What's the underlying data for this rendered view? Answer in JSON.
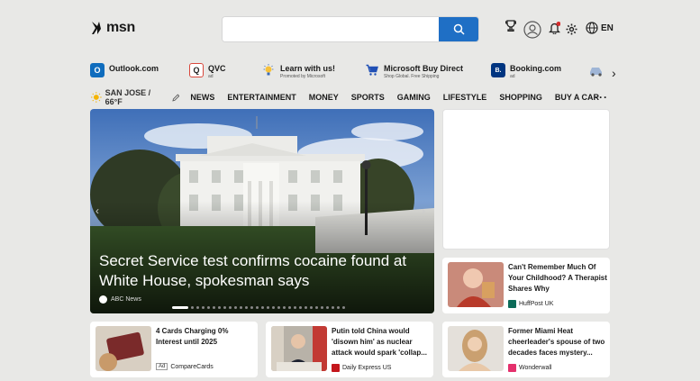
{
  "header": {
    "logo_text": "msn",
    "search_placeholder": "",
    "lang": "EN"
  },
  "quicklinks": [
    {
      "name": "Outlook.com",
      "sub": "",
      "color": "#0f6cbd",
      "glyph": "O"
    },
    {
      "name": "QVC",
      "sub": "ad",
      "color": "#ffffff",
      "glyph": "Q"
    },
    {
      "name": "Learn with us!",
      "sub": "Promoted by Microsoft",
      "color": "#ffffff",
      "glyph": ""
    },
    {
      "name": "Microsoft Buy Direct",
      "sub": "Shop Global. Free Shipping",
      "color": "#ffffff",
      "glyph": ""
    },
    {
      "name": "Booking.com",
      "sub": "ad",
      "color": "#003580",
      "glyph": "B."
    }
  ],
  "weather": {
    "text": "SAN JOSE / 66°F"
  },
  "nav": [
    "NEWS",
    "ENTERTAINMENT",
    "MONEY",
    "SPORTS",
    "GAMING",
    "LIFESTYLE",
    "SHOPPING",
    "BUY A CAR"
  ],
  "nav_more": "···",
  "hero": {
    "title": "Secret Service test confirms cocaine found at White House, spokesman says",
    "source": "ABC News",
    "slide_count": 30,
    "active_slide": 1
  },
  "cards": [
    {
      "title": "Can't Remember Much Of Your Childhood? A Therapist Shares Why",
      "source": "HuffPost UK",
      "ad": false,
      "logo_color": "#0c6b58"
    },
    {
      "title": "4 Cards Charging 0% Interest until 2025",
      "source": "CompareCards",
      "ad": true,
      "ad_label": "Ad",
      "logo_color": ""
    },
    {
      "title": "Putin told China would 'disown him' as nuclear attack would spark 'collap...",
      "source": "Daily Express US",
      "ad": false,
      "logo_color": "#c4161c"
    },
    {
      "title": "Former Miami Heat cheerleader's spouse of two decades faces mystery...",
      "source": "Wonderwall",
      "ad": false,
      "logo_color": "#e4306c"
    }
  ]
}
